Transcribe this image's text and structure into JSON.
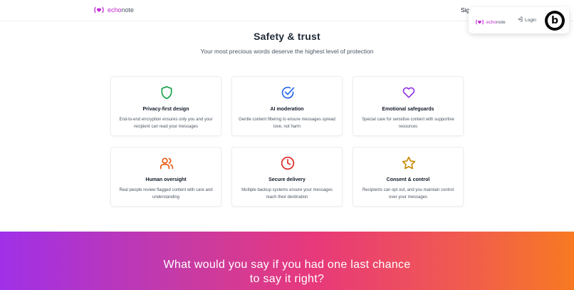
{
  "brand": {
    "echo": "echo",
    "note": "note"
  },
  "nav": {
    "sign_in_partial": "Sig"
  },
  "floating_menu": {
    "brand_echo": "echo",
    "brand_note": "note",
    "login_label": "Login",
    "badge_letter": "b"
  },
  "section": {
    "title": "Safety & trust",
    "subtitle": "Your most precious words deserve the highest level of protection"
  },
  "cards": [
    {
      "icon": "shield-icon",
      "color": "#16a34a",
      "title": "Privacy-first design",
      "desc": "End-to-end encryption ensures only you and your recipient can read your messages"
    },
    {
      "icon": "check-circle-icon",
      "color": "#2563eb",
      "title": "AI moderation",
      "desc": "Gentle content filtering to ensure messages spread love, not harm"
    },
    {
      "icon": "heart-icon",
      "color": "#9333ea",
      "title": "Emotional safeguards",
      "desc": "Special care for sensitive content with supportive resources"
    },
    {
      "icon": "users-icon",
      "color": "#ea580c",
      "title": "Human oversight",
      "desc": "Real people review flagged content with care and understanding"
    },
    {
      "icon": "clock-icon",
      "color": "#dc2626",
      "title": "Secure delivery",
      "desc": "Multiple backup systems ensure your messages reach their destination"
    },
    {
      "icon": "star-icon",
      "color": "#ca8a04",
      "title": "Consent & control",
      "desc": "Recipients can opt out, and you maintain control over your messages"
    }
  ],
  "banner": {
    "line1": "What would you say if you had one last chance",
    "line2": "to say it right?"
  },
  "colors": {
    "brand_accent": "#c026d3",
    "banner_gradient_start": "#a030e8",
    "banner_gradient_end": "#f77a22"
  }
}
